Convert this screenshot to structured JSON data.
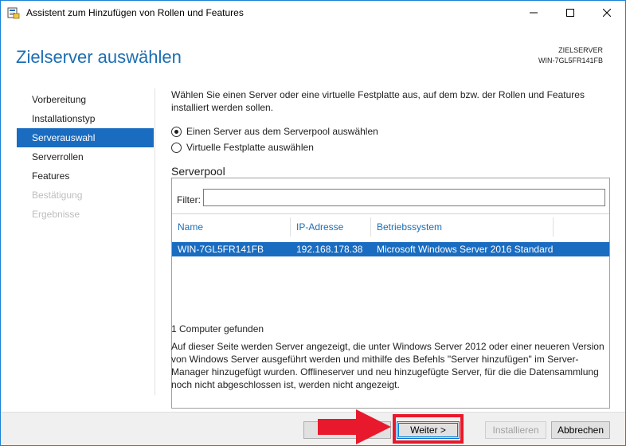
{
  "window": {
    "title": "Assistent zum Hinzufügen von Rollen und Features",
    "controls": [
      "minimize-icon",
      "maximize-icon",
      "close-icon"
    ]
  },
  "header": {
    "page_title": "Zielserver auswählen",
    "target_label": "ZIELSERVER",
    "target_name": "WIN-7GL5FR141FB"
  },
  "nav": {
    "items": [
      {
        "label": "Vorbereitung",
        "state": "normal"
      },
      {
        "label": "Installationstyp",
        "state": "normal"
      },
      {
        "label": "Serverauswahl",
        "state": "active"
      },
      {
        "label": "Serverrollen",
        "state": "normal"
      },
      {
        "label": "Features",
        "state": "normal"
      },
      {
        "label": "Bestätigung",
        "state": "disabled"
      },
      {
        "label": "Ergebnisse",
        "state": "disabled"
      }
    ]
  },
  "content": {
    "intro": "Wählen Sie einen Server oder eine virtuelle Festplatte aus, auf dem bzw. der Rollen und Features installiert werden sollen.",
    "options": [
      {
        "label": "Einen Server aus dem Serverpool auswählen",
        "checked": true
      },
      {
        "label": "Virtuelle Festplatte auswählen",
        "checked": false
      }
    ],
    "pool_title": "Serverpool",
    "filter_label": "Filter:",
    "filter_value": "",
    "columns": [
      "Name",
      "IP-Adresse",
      "Betriebssystem"
    ],
    "rows": [
      {
        "name": "WIN-7GL5FR141FB",
        "ip": "192.168.178.38",
        "os": "Microsoft Windows Server 2016 Standard",
        "selected": true
      }
    ],
    "count_text": "1 Computer gefunden",
    "description": "Auf dieser Seite werden Server angezeigt, die unter Windows Server 2012 oder einer neueren Version von Windows Server ausgeführt werden und mithilfe des Befehls \"Server hinzufügen\" im Server-Manager hinzugefügt wurden. Offlineserver und neu hinzugefügte Server, für die die Datensammlung noch nicht abgeschlossen ist, werden nicht angezeigt."
  },
  "footer": {
    "prev_label": "",
    "next_label": "Weiter >",
    "install_label": "Installieren",
    "cancel_label": "Abbrechen"
  },
  "colors": {
    "accent": "#1a6cc0",
    "title_blue": "#1c6eb3",
    "annotation_red": "#e8192c"
  }
}
